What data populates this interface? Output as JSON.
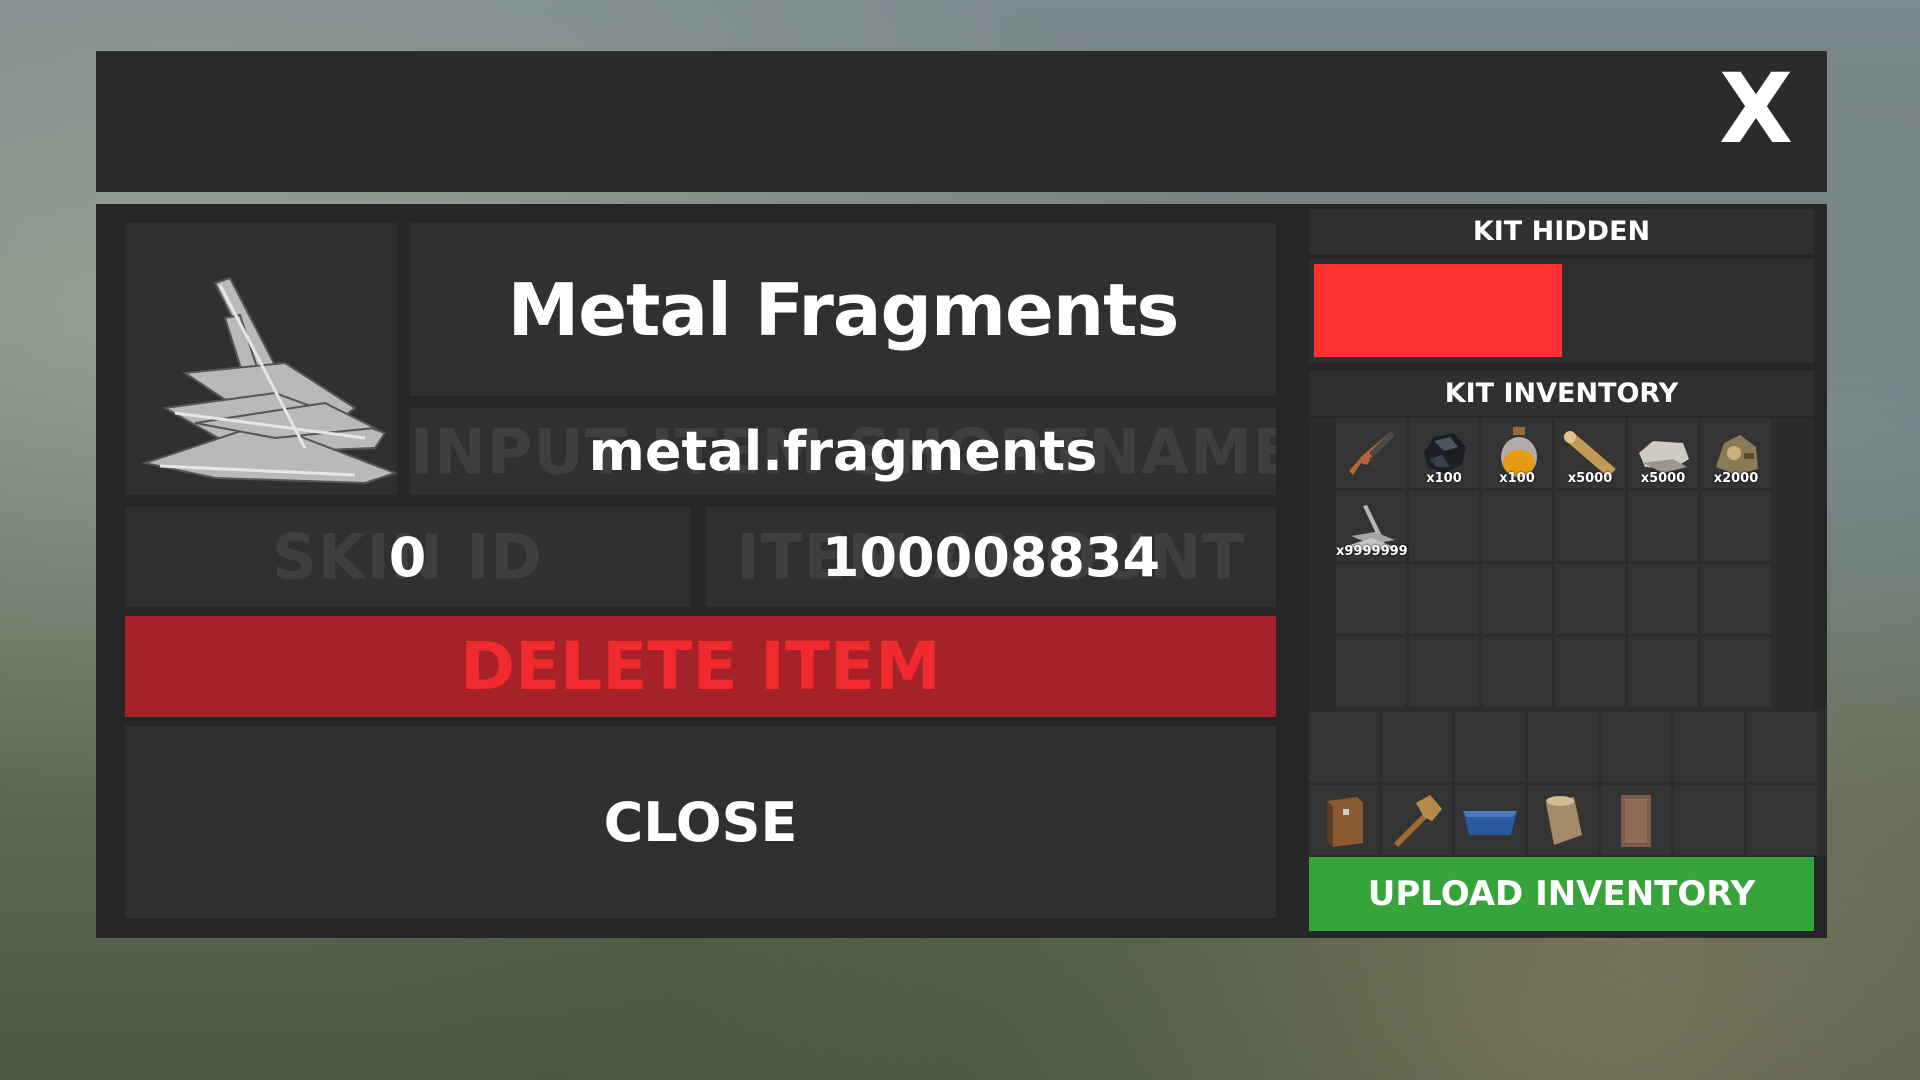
{
  "window": {
    "close_symbol": "X"
  },
  "item": {
    "name": "Metal Fragments",
    "shortname_placeholder": "INPUT ITEM SHORTNAME",
    "shortname": "metal.fragments",
    "skin_placeholder": "SKIN ID",
    "skin_id": "0",
    "amount_placeholder": "ITEM AMOUNT",
    "amount": "100008834",
    "icon": "metal-fragments-icon"
  },
  "buttons": {
    "delete_label": "DELETE ITEM",
    "close_label": "CLOSE",
    "upload_label": "UPLOAD INVENTORY"
  },
  "kit": {
    "hidden_label": "KIT HIDDEN",
    "hidden_color": "#ff3131",
    "inventory_label": "KIT INVENTORY",
    "main_slots": [
      {
        "icon": "assault-rifle-icon",
        "amount": ""
      },
      {
        "icon": "coal-icon",
        "amount": "x100"
      },
      {
        "icon": "oil-jar-icon",
        "amount": "x100"
      },
      {
        "icon": "wood-log-icon",
        "amount": "x5000"
      },
      {
        "icon": "stones-icon",
        "amount": "x5000"
      },
      {
        "icon": "scrap-icon",
        "amount": "x2000"
      },
      {
        "icon": "metal-fragments-icon",
        "amount": "x9999999+"
      }
    ],
    "belt_slots": [
      {
        "icon": "wooden-box-icon"
      },
      {
        "icon": "hammer-icon"
      },
      {
        "icon": "blue-tarp-icon"
      },
      {
        "icon": "tree-stump-icon"
      },
      {
        "icon": "wooden-door-icon"
      }
    ]
  },
  "colors": {
    "delete_bg": "#a52328",
    "delete_text": "#f02a2d",
    "upload_bg": "#37a33b"
  }
}
